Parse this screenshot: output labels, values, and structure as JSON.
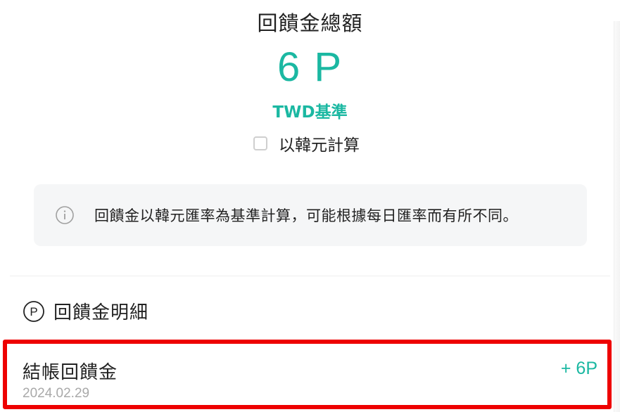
{
  "summary": {
    "title": "回饋金總額",
    "amount": "6 P",
    "currency_basis": "TWD基準",
    "accent_color": "#1bb8a2"
  },
  "krw_toggle": {
    "label": "以韓元計算",
    "checked": false
  },
  "notice": {
    "icon": "info-icon",
    "text": "回饋金以韓元匯率為基準計算，可能根據每日匯率而有所不同。"
  },
  "details": {
    "icon": "p-circle-icon",
    "title": "回饋金明細",
    "entries": [
      {
        "title": "結帳回饋金",
        "amount": "+ 6P",
        "date": "2024.02.29"
      }
    ]
  },
  "highlight_color": "#ee0000"
}
